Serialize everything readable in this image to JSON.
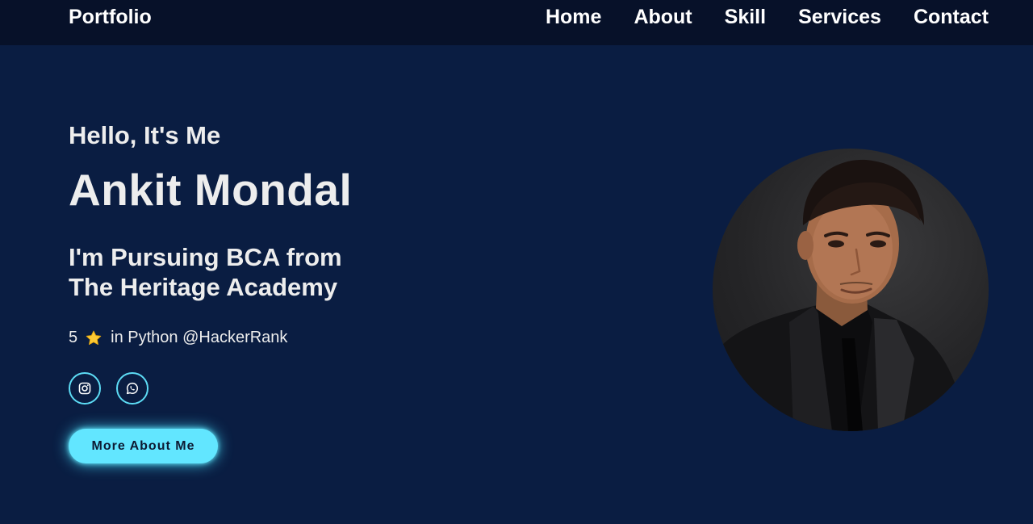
{
  "header": {
    "logo": "Portfolio",
    "nav": [
      "Home",
      "About",
      "Skill",
      "Services",
      "Contact"
    ]
  },
  "hero": {
    "greeting": "Hello, It's Me",
    "name": "Ankit Mondal",
    "tagline_line1": "I'm Pursuing BCA from",
    "tagline_line2": "The Heritage Academy",
    "rating_value": "5",
    "rating_text": "in Python @HackerRank",
    "cta_label": "More About Me"
  },
  "socials": [
    "instagram-icon",
    "whatsapp-icon"
  ],
  "colors": {
    "background": "#0a1d42",
    "header": "#071129",
    "accent": "#62e6ff",
    "text": "#ededed"
  }
}
